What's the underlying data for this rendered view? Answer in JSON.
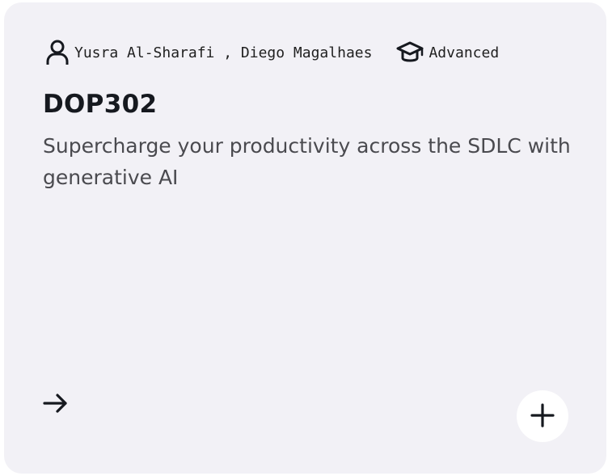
{
  "session": {
    "speakers": "Yusra Al-Sharafi , Diego Magalhaes",
    "level": "Advanced",
    "code": "DOP302",
    "description": "Supercharge your productivity across the SDLC with generative AI"
  },
  "icons": {
    "speakers": "user-icon",
    "level": "graduation-cap-icon",
    "link": "arrow-right-icon",
    "add": "plus-icon"
  },
  "colors": {
    "card_background": "#f2f1f6",
    "title": "#16191f",
    "body_text": "#4a4a4f",
    "add_button_background": "#ffffff"
  }
}
